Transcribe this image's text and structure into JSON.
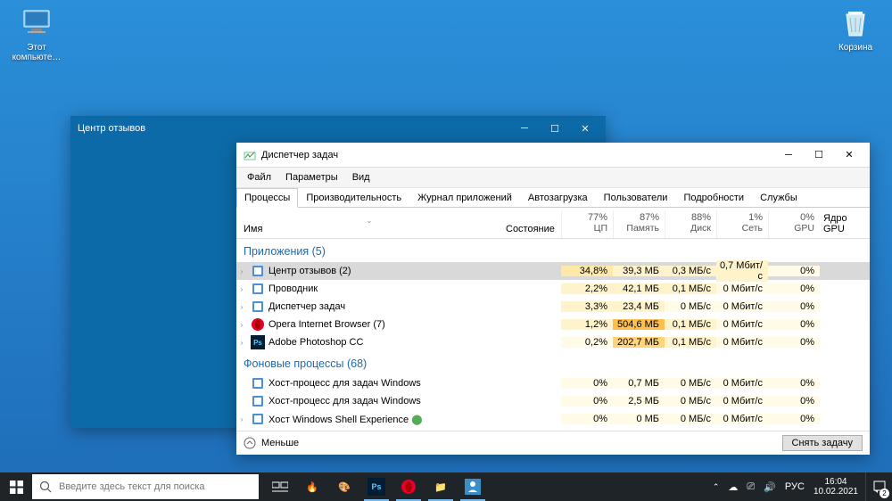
{
  "desktop": {
    "icons": {
      "pc": "Этот\nкомпьюте…",
      "bin": "Корзина"
    }
  },
  "feedback_window": {
    "title": "Центр отзывов"
  },
  "taskmgr": {
    "title": "Диспетчер задач",
    "menu": [
      "Файл",
      "Параметры",
      "Вид"
    ],
    "tabs": [
      "Процессы",
      "Производительность",
      "Журнал приложений",
      "Автозагрузка",
      "Пользователи",
      "Подробности",
      "Службы"
    ],
    "active_tab": 0,
    "columns": {
      "name": "Имя",
      "state": "Состояние",
      "cpu": {
        "pct": "77%",
        "label": "ЦП"
      },
      "mem": {
        "pct": "87%",
        "label": "Память"
      },
      "disk": {
        "pct": "88%",
        "label": "Диск"
      },
      "net": {
        "pct": "1%",
        "label": "Сеть"
      },
      "gpu": {
        "pct": "0%",
        "label": "GPU"
      },
      "gpu_eng": "Ядро GPU"
    },
    "groups": [
      {
        "label": "Приложения (5)",
        "rows": [
          {
            "name": "Центр отзывов (2)",
            "cpu": "34,8%",
            "mem": "39,3 МБ",
            "disk": "0,3 МБ/с",
            "net": "0,7 Мбит/с",
            "gpu": "0%",
            "sel": true,
            "exp": true,
            "heat": [
              2,
              1,
              1,
              1,
              0
            ]
          },
          {
            "name": "Проводник",
            "cpu": "2,2%",
            "mem": "42,1 МБ",
            "disk": "0,1 МБ/с",
            "net": "0 Мбит/с",
            "gpu": "0%",
            "exp": true,
            "heat": [
              1,
              1,
              1,
              0,
              0
            ]
          },
          {
            "name": "Диспетчер задач",
            "cpu": "3,3%",
            "mem": "23,4 МБ",
            "disk": "0 МБ/с",
            "net": "0 Мбит/с",
            "gpu": "0%",
            "exp": true,
            "heat": [
              1,
              1,
              0,
              0,
              0
            ]
          },
          {
            "name": "Opera Internet Browser (7)",
            "cpu": "1,2%",
            "mem": "504,6 МБ",
            "disk": "0,1 МБ/с",
            "net": "0 Мбит/с",
            "gpu": "0%",
            "exp": true,
            "heat": [
              1,
              4,
              1,
              0,
              0
            ],
            "icon": "opera"
          },
          {
            "name": "Adobe Photoshop CC",
            "cpu": "0,2%",
            "mem": "202,7 МБ",
            "disk": "0,1 МБ/с",
            "net": "0 Мбит/с",
            "gpu": "0%",
            "exp": true,
            "heat": [
              0,
              3,
              1,
              0,
              0
            ],
            "icon": "ps"
          }
        ]
      },
      {
        "label": "Фоновые процессы (68)",
        "rows": [
          {
            "name": "Хост-процесс для задач Windows",
            "cpu": "0%",
            "mem": "0,7 МБ",
            "disk": "0 МБ/с",
            "net": "0 Мбит/с",
            "gpu": "0%",
            "heat": [
              0,
              0,
              0,
              0,
              0
            ]
          },
          {
            "name": "Хост-процесс для задач Windows",
            "cpu": "0%",
            "mem": "2,5 МБ",
            "disk": "0 МБ/с",
            "net": "0 Мбит/с",
            "gpu": "0%",
            "heat": [
              0,
              0,
              0,
              0,
              0
            ]
          },
          {
            "name": "Хост Windows Shell Experience",
            "cpu": "0%",
            "mem": "0 МБ",
            "disk": "0 МБ/с",
            "net": "0 Мбит/с",
            "gpu": "0%",
            "exp": true,
            "leaf": true,
            "heat": [
              0,
              0,
              0,
              0,
              0
            ]
          }
        ]
      }
    ],
    "fewer": "Меньше",
    "end_task": "Снять задачу"
  },
  "taskbar": {
    "search_placeholder": "Введите здесь текст для поиска",
    "lang": "РУС",
    "time": "16:04",
    "date": "10.02.2021",
    "notif_count": "2"
  }
}
